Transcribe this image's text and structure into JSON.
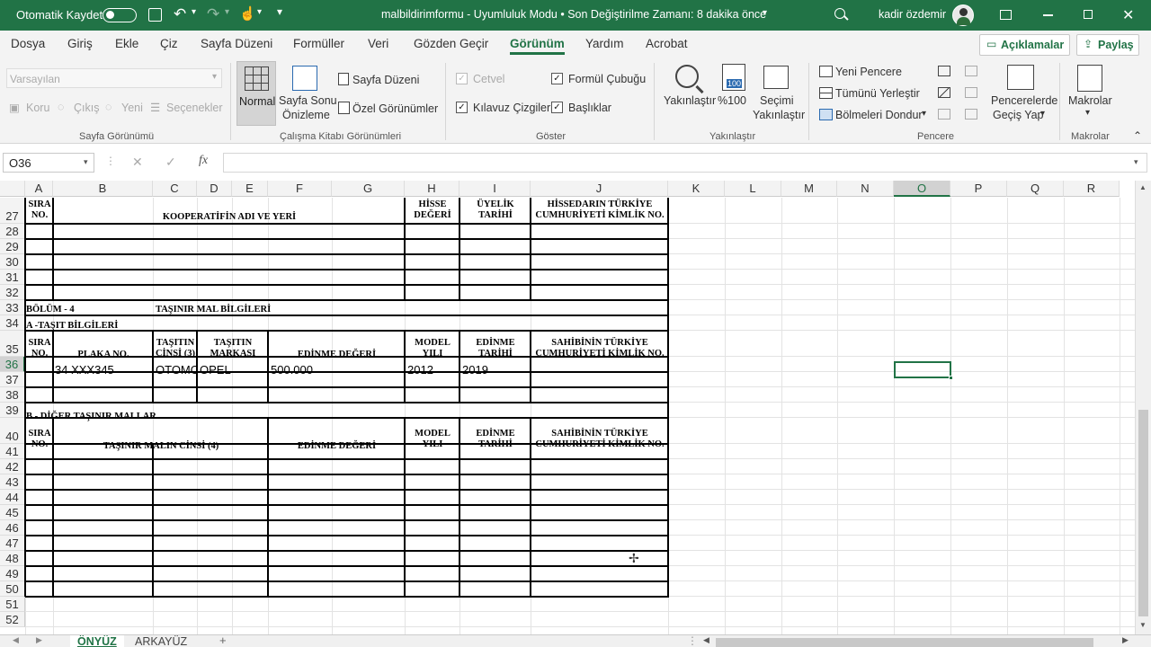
{
  "titlebar": {
    "autosave_label": "Otomatik Kaydet",
    "doc_title": "malbildirimformu  -  Uyumluluk Modu • Son Değiştirilme Zamanı: 8 dakika önce",
    "user_name": "kadir özdemir"
  },
  "menu": {
    "items": [
      "Dosya",
      "Giriş",
      "Ekle",
      "Çiz",
      "Sayfa Düzeni",
      "Formüller",
      "Veri",
      "Gözden Geçir",
      "Görünüm",
      "Yardım",
      "Acrobat"
    ],
    "active": "Görünüm",
    "comments_label": "Açıklamalar",
    "share_label": "Paylaş"
  },
  "ribbon": {
    "sheet_view": {
      "dropdown": "Varsayılan",
      "keep": "Koru",
      "exit": "Çıkış",
      "new": "Yeni",
      "options": "Seçenekler",
      "label": "Sayfa Görünümü"
    },
    "workbook_views": {
      "normal": "Normal",
      "page_break_1": "Sayfa Sonu",
      "page_break_2": "Önizleme",
      "page_layout": "Sayfa Düzeni",
      "custom_views": "Özel Görünümler",
      "label": "Çalışma Kitabı Görünümleri"
    },
    "show": {
      "ruler": "Cetvel",
      "formula_bar": "Formül Çubuğu",
      "gridlines": "Kılavuz Çizgileri",
      "headings": "Başlıklar",
      "label": "Göster"
    },
    "zoom": {
      "zoom": "Yakınlaştır",
      "hundred": "%100",
      "hundred_icon": "100",
      "sel_1": "Seçimi",
      "sel_2": "Yakınlaştır",
      "label": "Yakınlaştır"
    },
    "window": {
      "new_window": "Yeni Pencere",
      "arrange_all": "Tümünü Yerleştir",
      "freeze": "Bölmeleri Dondur",
      "switch_1": "Pencerelerde",
      "switch_2": "Geçiş Yap",
      "label": "Pencere"
    },
    "macros": {
      "macros": "Makrolar",
      "label": "Makrolar"
    }
  },
  "formula": {
    "name_box": "O36",
    "fx": "fx",
    "cancel": "✕",
    "enter": "✓",
    "value": ""
  },
  "columns": [
    "A",
    "B",
    "C",
    "D",
    "E",
    "F",
    "G",
    "H",
    "I",
    "J",
    "K",
    "L",
    "M",
    "N",
    "O",
    "P",
    "Q",
    "R"
  ],
  "rows": [
    "27",
    "28",
    "29",
    "30",
    "31",
    "32",
    "33",
    "34",
    "35",
    "36",
    "37",
    "38",
    "39",
    "40",
    "41",
    "42",
    "43",
    "44",
    "45",
    "46",
    "47",
    "48",
    "49",
    "50",
    "51",
    "52"
  ],
  "form": {
    "sira_1": "SIRA",
    "no_1": "NO.",
    "koop": "KOOPERATİFİN ADI VE YERİ",
    "hisse_1": "HİSSE",
    "hisse_2": "DEĞERİ",
    "uyelik_1": "ÜYELİK",
    "uyelik_2": "TARİHİ",
    "hissedar_1": "HİSSEDARIN TÜRKİYE",
    "hissedar_2": "CUMHURİYETİ KİMLİK NO.",
    "bolum": "BÖLÜM - 4",
    "tasinir_title": "TAŞINIR MAL BİLGİLERİ",
    "tasit_title": "A -TAŞIT BİLGİLERİ",
    "sira_2": "SIRA",
    "no_2": "NO.",
    "plaka": "PLAKA NO.",
    "tasit_cinsi_1": "TAŞITIN",
    "tasit_cinsi_2": "CİNSİ (3)",
    "tasit_marka_1": "TAŞITIN",
    "tasit_marka_2": "MARKASI",
    "edinme_degeri_1": "EDİNME DEĞERİ",
    "model_1": "MODEL",
    "yili_1": "YILI",
    "edinme_t1": "EDİNME",
    "tarihi_1": "TARİHİ",
    "sahibi_1": "SAHİBİNİN TÜRKİYE",
    "kimlik_1": "CUMHURİYETİ KİMLİK NO.",
    "row36": {
      "plaka": "34 XXX345",
      "cinsi": "OTOMOBİL",
      "marka": "OPEL",
      "deger": "500.000",
      "model": "2012",
      "tarih": "2019"
    },
    "diger_title": "B - DİĞER TAŞINIR MALLAR",
    "sira_3": "SIRA",
    "no_3": "NO.",
    "cins4": "TAŞINIR MALIN CİNSİ (4)",
    "edinme_degeri_2": "EDİNME DEĞERİ",
    "model_2": "MODEL",
    "yili_2": "YILI",
    "edinme_t2": "EDİNME",
    "tarihi_2": "TARİHİ",
    "sahibi_2": "SAHİBİNİN TÜRKİYE",
    "kimlik_2": "CUMHURİYETİ KİMLİK NO."
  },
  "sheets": {
    "tabs": [
      "ÖNYÜZ",
      "ARKAYÜZ"
    ],
    "active": "ÖNYÜZ",
    "add": "+"
  },
  "colors": {
    "excel_green": "#217346",
    "selection_green": "#217346"
  }
}
